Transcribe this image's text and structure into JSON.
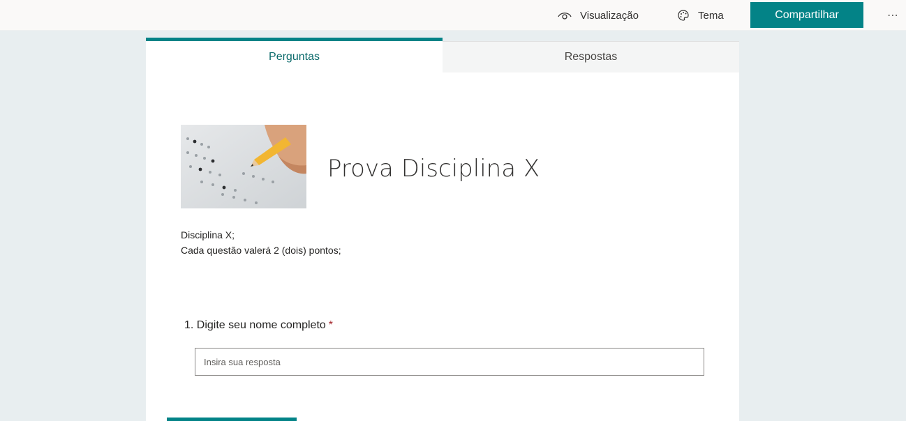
{
  "topbar": {
    "preview_label": "Visualização",
    "preview_icon": "eye-icon",
    "theme_label": "Tema",
    "theme_icon": "palette-icon",
    "share_label": "Compartilhar",
    "more_label": "⋯",
    "accent_color": "#038387"
  },
  "tabs": [
    {
      "label": "Perguntas",
      "active": true
    },
    {
      "label": "Respostas",
      "active": false
    }
  ],
  "form": {
    "image_icon": "answer-sheet-pencil-image",
    "title": "Prova Disciplina X",
    "description_line1": "Disciplina X;",
    "description_line2": "Cada questão valerá 2 (dois) pontos;"
  },
  "questions": [
    {
      "number": "1.",
      "text": "Digite seu nome completo",
      "required_mark": "*",
      "placeholder": "Insira sua resposta",
      "value": ""
    }
  ]
}
